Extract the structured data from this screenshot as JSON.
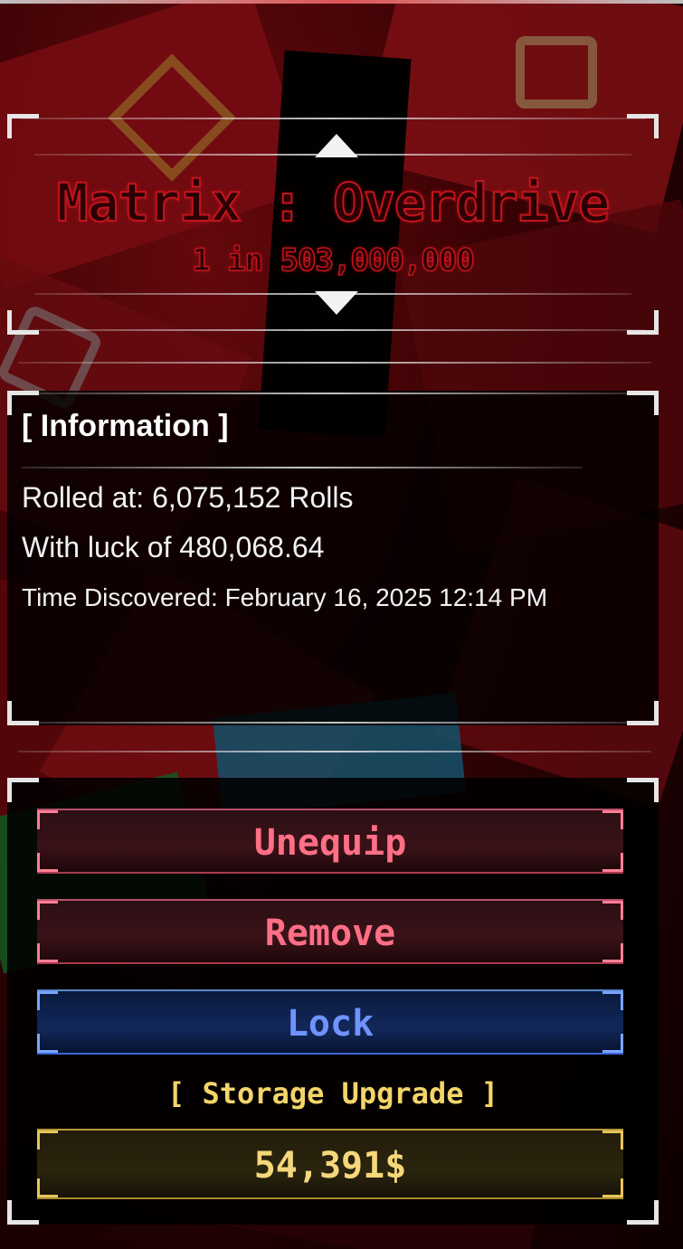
{
  "aura": {
    "name": "Matrix : Overdrive",
    "chance": "1 in 503,000,000"
  },
  "information": {
    "heading": "[ Information ]",
    "rolled_at": "Rolled at: 6,075,152 Rolls",
    "luck": "With luck of 480,068.64",
    "time_discovered": "Time Discovered: February 16, 2025 12:14 PM"
  },
  "actions": {
    "unequip_label": "Unequip",
    "remove_label": "Remove",
    "lock_label": "Lock",
    "storage_upgrade_label": "[ Storage Upgrade ]",
    "storage_upgrade_price": "54,391$"
  },
  "colors": {
    "aura_accent": "#c2141c",
    "danger": "#ff6f85",
    "lock": "#6f93ff",
    "gold": "#f4d56a"
  },
  "icons": {
    "previous": "arrow-up-icon",
    "next": "arrow-down-icon"
  }
}
